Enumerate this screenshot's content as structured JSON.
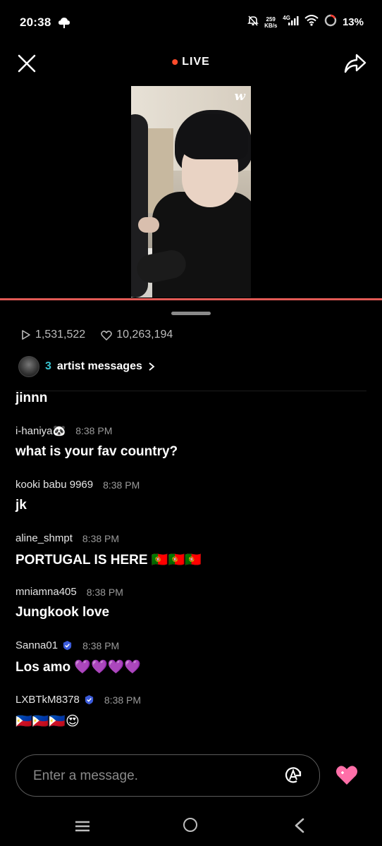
{
  "status_bar": {
    "time": "20:38",
    "speed_value": "259",
    "speed_unit": "KB/s",
    "network": "4G",
    "battery": "13%",
    "icons": [
      "cloud-icon",
      "mute-icon",
      "signal-icon",
      "wifi-icon",
      "battery-ring-icon"
    ]
  },
  "header": {
    "live_label": "LIVE",
    "live_dot_color": "#ff4b2b",
    "close_icon": "close-icon",
    "share_icon": "share-icon"
  },
  "video": {
    "watermark": "w",
    "progress_color": "#e25a55"
  },
  "stats": {
    "plays": "1,531,522",
    "likes": "10,263,194"
  },
  "artist_messages": {
    "count": "3",
    "label": "artist messages",
    "accent": "#39c4d0"
  },
  "chat": {
    "partial_message": "jinnn",
    "messages": [
      {
        "user": "i-haniya🐼",
        "verified": false,
        "time": "8:38 PM",
        "text": "what is your fav country?"
      },
      {
        "user": "kooki babu 9969",
        "verified": false,
        "time": "8:38 PM",
        "text": "jk"
      },
      {
        "user": "aline_shmpt",
        "verified": false,
        "time": "8:38 PM",
        "text": "PORTUGAL IS HERE 🇵🇹🇵🇹🇵🇹"
      },
      {
        "user": "mniamna405",
        "verified": false,
        "time": "8:38 PM",
        "text": "Jungkook love"
      },
      {
        "user": "Sanna01",
        "verified": true,
        "time": "8:38 PM",
        "text": "Los amo 💜💜💜💜"
      },
      {
        "user": "LXBTkM8378",
        "verified": true,
        "time": "8:38 PM",
        "text": "🇵🇭🇵🇭🇵🇭😍"
      }
    ]
  },
  "composer": {
    "placeholder": "Enter a message.",
    "heart_color": "#ff6fa8"
  },
  "nav": {
    "icons": [
      "recent-apps-icon",
      "home-icon",
      "back-icon"
    ]
  }
}
